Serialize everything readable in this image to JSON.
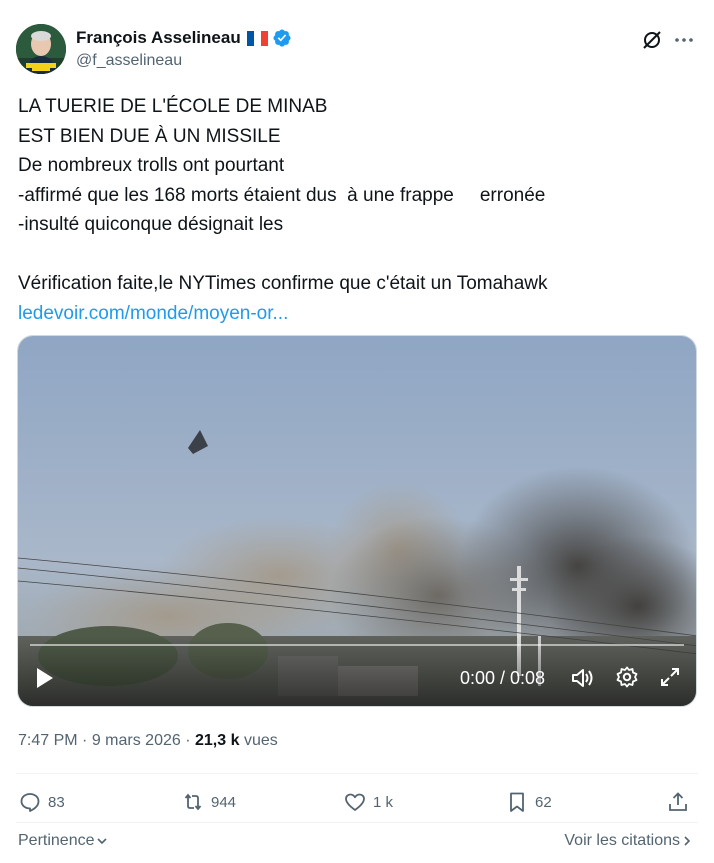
{
  "author": {
    "display_name": "François Asselineau",
    "handle": "@f_asselineau"
  },
  "tweet": {
    "line1": "LA TUERIE DE L'ÉCOLE DE MINAB",
    "line2": "EST BIEN DUE À UN MISSILE",
    "line3": "De nombreux trolls ont pourtant",
    "line4a": "-affirmé que les 168 morts étaient dus  à une frappe",
    "line4b": "erronée",
    "line5": "-insulté quiconque désignait les",
    "line6": "Vérification faite,le NYTimes confirme que c'était un Tomahawk",
    "link": "ledevoir.com/monde/moyen-or..."
  },
  "video": {
    "time": "0:00 / 0:08",
    "progress": 0
  },
  "meta": {
    "time": "7:47 PM",
    "date": "9 mars 2026",
    "views_count": "21,3 k",
    "views_label": "vues",
    "separator": "·"
  },
  "actions": {
    "replies": "83",
    "reposts": "944",
    "likes": "1 k",
    "bookmarks": "62"
  },
  "footer": {
    "sort": "Pertinence",
    "quotes": "Voir les citations"
  },
  "colors": {
    "accent": "#1d9bf0",
    "text": "#0f1419",
    "secondary": "#536471"
  }
}
